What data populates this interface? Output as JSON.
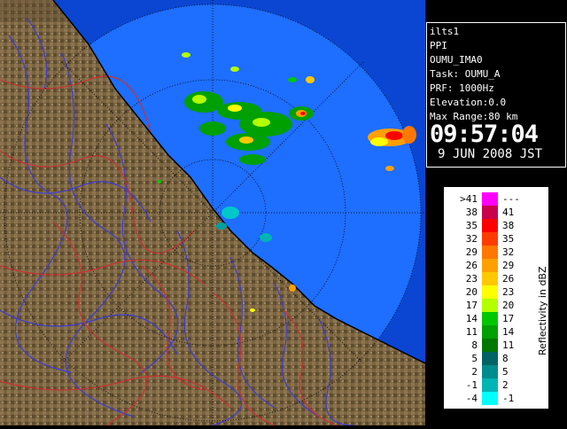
{
  "info": {
    "site": "ilts1",
    "mode": "PPI",
    "product": "OUMU_IMA0",
    "task": "Task: OUMU_A",
    "prf": "PRF: 1000Hz",
    "elevation": "Elevation:0.0",
    "max_range": "Max Range:80 km",
    "time": "09:57:04",
    "date": "9 JUN 2008 JST"
  },
  "legend": {
    "unit": "Reflectivity in dBZ",
    "rows": [
      {
        "left": ">41",
        "right": "---",
        "color": "#ff00ff"
      },
      {
        "left": "38",
        "right": "41",
        "color": "#c8004b"
      },
      {
        "left": "35",
        "right": "38",
        "color": "#ff0000"
      },
      {
        "left": "32",
        "right": "35",
        "color": "#ff3c00"
      },
      {
        "left": "29",
        "right": "32",
        "color": "#ff7800"
      },
      {
        "left": "26",
        "right": "29",
        "color": "#ffa000"
      },
      {
        "left": "23",
        "right": "26",
        "color": "#ffc800"
      },
      {
        "left": "20",
        "right": "23",
        "color": "#ffff00"
      },
      {
        "left": "17",
        "right": "20",
        "color": "#b4ff00"
      },
      {
        "left": "14",
        "right": "17",
        "color": "#00c800"
      },
      {
        "left": "11",
        "right": "14",
        "color": "#00a000"
      },
      {
        "left": "8",
        "right": "11",
        "color": "#007800"
      },
      {
        "left": "5",
        "right": "8",
        "color": "#006464"
      },
      {
        "left": "2",
        "right": "5",
        "color": "#008c8c"
      },
      {
        "left": "-1",
        "right": "2",
        "color": "#00b4b4"
      },
      {
        "left": "-4",
        "right": "-1",
        "color": "#00ffff"
      }
    ]
  },
  "colors": {
    "radar_field": "#1e6eff",
    "outside_range": "#0a46d2",
    "land": "#7a6440",
    "rivers": "#3c3cd2",
    "boundaries": "#c83232",
    "range_rings": "#000000"
  }
}
